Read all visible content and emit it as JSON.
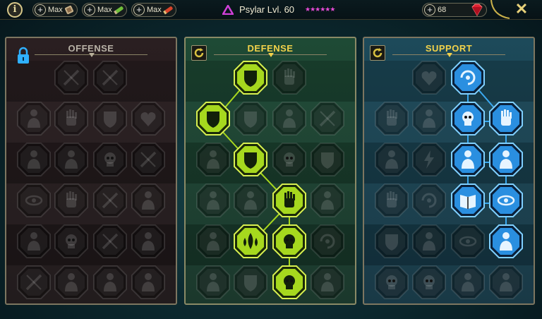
{
  "topbar": {
    "info_label": "i",
    "resources": [
      {
        "label": "Max",
        "icon": "potion-scroll-icon"
      },
      {
        "label": "Max",
        "icon": "green-scroll-icon"
      },
      {
        "label": "Max",
        "icon": "red-scroll-icon"
      }
    ],
    "player_title": "Psylar Lvl. 60",
    "stars": "★★★★★★",
    "gems": "68",
    "close_label": "✕",
    "accent_color": "#e84bd8"
  },
  "panels": [
    {
      "id": "offense",
      "title": "OFFENSE",
      "state": "locked",
      "color": "#8a7d7d"
    },
    {
      "id": "defense",
      "title": "DEFENSE",
      "state": "active",
      "color": "#b6e02a"
    },
    {
      "id": "support",
      "title": "SUPPORT",
      "state": "active",
      "color": "#2fa6f0"
    }
  ],
  "offense_nodes": [
    {
      "icon": "crossed-swords-icon",
      "active": false
    },
    {
      "icon": "claw-slash-icon",
      "active": false
    },
    {
      "icon": "muscle-warrior-icon",
      "active": false
    },
    {
      "icon": "winged-fist-icon",
      "active": false
    },
    {
      "icon": "shield-slash-icon",
      "active": false
    },
    {
      "icon": "heart-crack-icon",
      "active": false
    },
    {
      "icon": "horse-chess-icon",
      "active": false
    },
    {
      "icon": "fang-maw-icon",
      "active": false
    },
    {
      "icon": "skull-icon",
      "active": false
    },
    {
      "icon": "scythe-icon",
      "active": false
    },
    {
      "icon": "target-eye-icon",
      "active": false
    },
    {
      "icon": "fist-strike-icon",
      "active": false
    },
    {
      "icon": "axe-icon",
      "active": false
    },
    {
      "icon": "chains-icon",
      "active": false
    },
    {
      "icon": "spider-icon",
      "active": false
    },
    {
      "icon": "skull-alt-icon",
      "active": false
    },
    {
      "icon": "blade-circle-icon",
      "active": false
    },
    {
      "icon": "brute-icon",
      "active": false
    },
    {
      "icon": "sword-cross-icon",
      "active": false
    },
    {
      "icon": "helmet-icon",
      "active": false
    },
    {
      "icon": "fire-demon-icon",
      "active": false
    },
    {
      "icon": "spartan-helmet-icon",
      "active": false
    }
  ],
  "defense_nodes": [
    {
      "icon": "armor-plates-icon",
      "active": true
    },
    {
      "icon": "raised-fist-icon",
      "active": false
    },
    {
      "icon": "chevron-shield-icon",
      "active": true
    },
    {
      "icon": "heart-shield-icon",
      "active": false
    },
    {
      "icon": "guardian-icon",
      "active": false
    },
    {
      "icon": "slash-block-icon",
      "active": false
    },
    {
      "icon": "moon-warrior-icon",
      "active": false
    },
    {
      "icon": "knight-shield-icon",
      "active": true
    },
    {
      "icon": "skull-shield-icon",
      "active": false
    },
    {
      "icon": "face-shield-icon",
      "active": false
    },
    {
      "icon": "bodyguard-icon",
      "active": false
    },
    {
      "icon": "hourglass-icon",
      "active": false
    },
    {
      "icon": "open-hand-icon",
      "active": true
    },
    {
      "icon": "bull-icon",
      "active": false
    },
    {
      "icon": "runner-icon",
      "active": false
    },
    {
      "icon": "drops-icon",
      "active": true
    },
    {
      "icon": "sun-skull-icon",
      "active": true
    },
    {
      "icon": "swirl-icon",
      "active": false
    },
    {
      "icon": "brain-icon",
      "active": false
    },
    {
      "icon": "split-shield-icon",
      "active": false
    },
    {
      "icon": "horned-skull-icon",
      "active": true
    },
    {
      "icon": "warrior-icon",
      "active": false
    }
  ],
  "support_nodes": [
    {
      "icon": "heart-plus-icon",
      "active": false
    },
    {
      "icon": "swirl-target-icon",
      "active": true
    },
    {
      "icon": "praying-hands-icon",
      "active": false
    },
    {
      "icon": "arch-icon",
      "active": false
    },
    {
      "icon": "flame-skull-icon",
      "active": true
    },
    {
      "icon": "charging-hand-icon",
      "active": true
    },
    {
      "icon": "cleric-icon",
      "active": false
    },
    {
      "icon": "lightning-icon",
      "active": false
    },
    {
      "icon": "fissure-icon",
      "active": true
    },
    {
      "icon": "shadow-figure-icon",
      "active": true
    },
    {
      "icon": "heart-hands-icon",
      "active": false
    },
    {
      "icon": "comet-icon",
      "active": false
    },
    {
      "icon": "spell-book-icon",
      "active": true
    },
    {
      "icon": "angry-eyes-icon",
      "active": true
    },
    {
      "icon": "star-shield-icon",
      "active": false
    },
    {
      "icon": "scroll-stack-icon",
      "active": false
    },
    {
      "icon": "eye-icon",
      "active": false
    },
    {
      "icon": "bound-figure-icon",
      "active": true
    },
    {
      "icon": "gear-skull-icon",
      "active": false
    },
    {
      "icon": "skull-flat-icon",
      "active": false
    },
    {
      "icon": "helm-plate-icon",
      "active": false
    },
    {
      "icon": "eagle-icon",
      "active": false
    }
  ]
}
